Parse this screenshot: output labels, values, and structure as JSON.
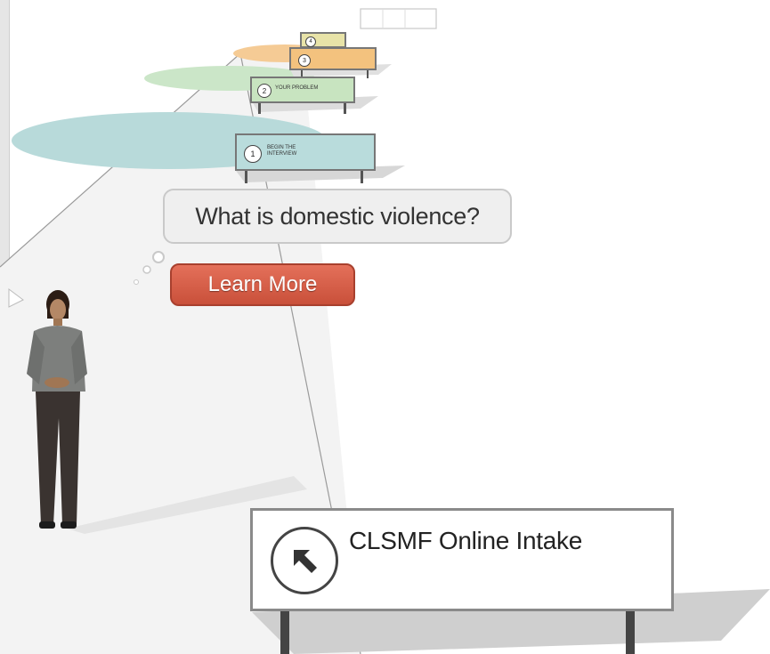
{
  "speech_bubble": {
    "question": "What is domestic violence?"
  },
  "learn_more_button": {
    "label": "Learn More"
  },
  "main_sign": {
    "title": "CLSMF Online Intake",
    "icon": "arrow-up-left-icon"
  },
  "path_signs": [
    {
      "number": "1",
      "label": "BEGIN THE INTERVIEW",
      "color": "#b9dcdc"
    },
    {
      "number": "2",
      "label": "YOUR PROBLEM",
      "color": "#c8e4c0"
    },
    {
      "number": "3",
      "label": "",
      "color": "#f3c27e"
    },
    {
      "number": "4",
      "label": "",
      "color": "#e8e3a8"
    }
  ]
}
